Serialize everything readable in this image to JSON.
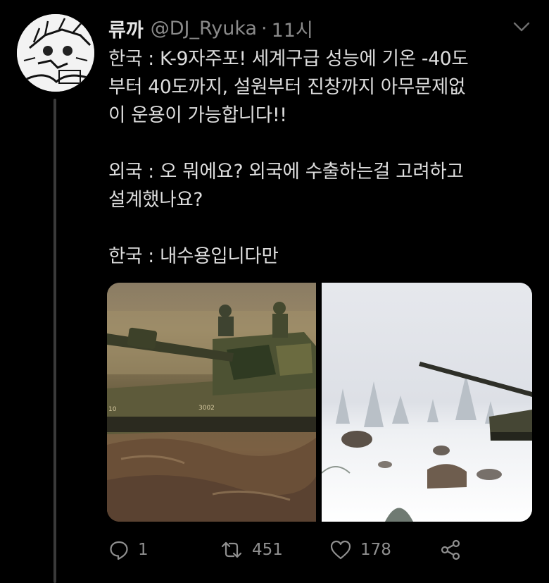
{
  "tweet": {
    "author_name": "류까",
    "handle": "@DJ_Ryuka",
    "separator": "·",
    "time": "11시",
    "text_lines": [
      "한국 : K-9자주포! 세계구급 성능에 기온 -40도",
      "부터 40도까지, 설원부터 진창까지 아무문제없",
      "이 운용이 가능합니다!!",
      "",
      "외국 : 오 뭐에요? 외국에 수출하는걸 고려하고",
      "설계했나요?",
      "",
      "한국 : 내수용입니다만"
    ],
    "media": [
      {
        "description_icon": "self-propelled-howitzer-mud-photo",
        "hull_markings": [
          "10",
          "3002"
        ]
      },
      {
        "description_icon": "self-propelled-howitzer-snow-photo"
      }
    ],
    "actions": {
      "reply_count": "1",
      "retweet_count": "451",
      "like_count": "178"
    }
  },
  "colors": {
    "background": "#000000",
    "text": "#dedede",
    "muted": "#8a8a8a",
    "thread_line": "#3a3a3a"
  }
}
